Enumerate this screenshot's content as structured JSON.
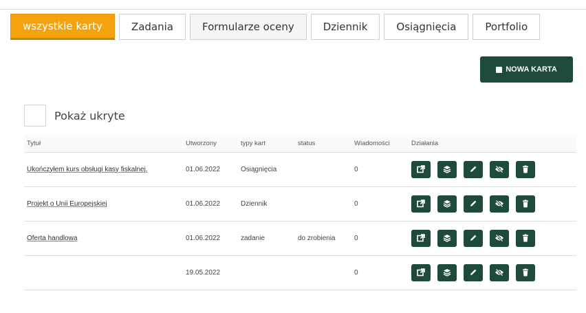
{
  "tabs": [
    {
      "label": "wszystkie karty",
      "active": true
    },
    {
      "label": "Zadania",
      "active": false
    },
    {
      "label": "Formularze oceny",
      "active": false
    },
    {
      "label": "Dziennik",
      "active": false
    },
    {
      "label": "Osiągnięcia",
      "active": false
    },
    {
      "label": "Portfolio",
      "active": false
    }
  ],
  "new_card_button": {
    "label": "NOWA KARTA"
  },
  "show_hidden": {
    "label": "Pokaż ukryte",
    "checked": false
  },
  "table": {
    "headers": {
      "title": "Tytuł",
      "created": "Utworzony",
      "types": "typy kart",
      "status": "status",
      "messages": "Wiadomości",
      "actions": "Działania"
    },
    "rows": [
      {
        "title": "Ukończyłem kurs obsługi kasy fiskalnej.",
        "created": "01.06.2022",
        "type": "Osiągnięcia",
        "status": "",
        "messages": "0"
      },
      {
        "title": "Projekt o Unii Europejskiej",
        "created": "01.06.2022",
        "type": "Dziennik",
        "status": "",
        "messages": "0"
      },
      {
        "title": "Oferta handlowa",
        "created": "01.06.2022",
        "type": "zadanie",
        "status": "do zrobienia",
        "messages": "0"
      },
      {
        "title": "",
        "created": "19.05.2022",
        "type": "",
        "status": "",
        "messages": "0"
      }
    ]
  },
  "action_icons": [
    "open-external-icon",
    "layers-icon",
    "pencil-icon",
    "eye-slash-icon",
    "trash-icon"
  ],
  "colors": {
    "accent": "#f4a30f",
    "primary_dark": "#1e4a3c"
  }
}
